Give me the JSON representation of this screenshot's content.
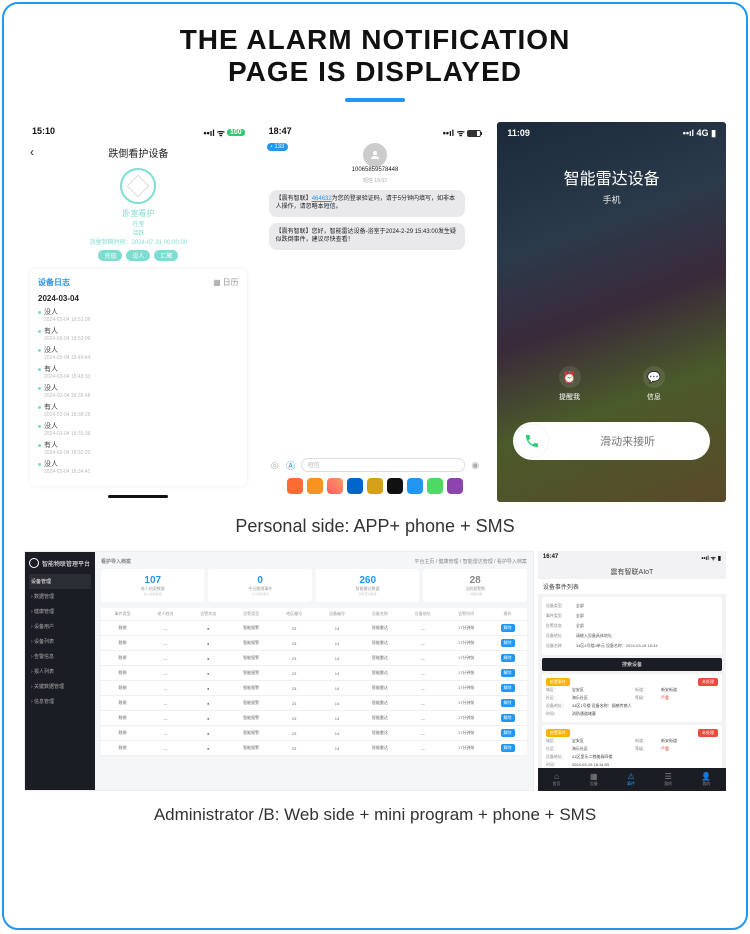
{
  "title_line1": "THE ALARM NOTIFICATION",
  "title_line2": "PAGE IS DISPLAYED",
  "phone1": {
    "time": "15:10",
    "battery": "100",
    "title": "跌倒看护设备",
    "device_name": "卧室看护",
    "device_state": "在室",
    "device_sub": "活跃",
    "device_time": "流量到期时间：2024-07-31 00:00:00",
    "chips": [
      "充值",
      "设人",
      "汇聚"
    ],
    "card_title": "设备日志",
    "calendar": "日历",
    "date": "2024-03-04",
    "logs": [
      {
        "label": "没人",
        "ts": "2024-03-04 18:52:09"
      },
      {
        "label": "有人",
        "ts": "2024-03-04 18:52:09"
      },
      {
        "label": "没人",
        "ts": "2024-03-04 18:48:44"
      },
      {
        "label": "有人",
        "ts": "2024-03-04 18:48:33"
      },
      {
        "label": "没人",
        "ts": "2024-03-04 18:38:48"
      },
      {
        "label": "有人",
        "ts": "2024-03-04 18:38:26"
      },
      {
        "label": "没人",
        "ts": "2024-03-04 18:35:38"
      },
      {
        "label": "有人",
        "ts": "2024-03-04 18:32:20"
      },
      {
        "label": "没人",
        "ts": "2024-03-04 18:34:41"
      }
    ]
  },
  "phone2": {
    "time": "18:47",
    "back_count": "133",
    "phone_number": "10065859578448",
    "meta": "短信 15:07",
    "msg1_prefix": "【震有智联】",
    "msg1_code": "464632",
    "msg1_rest": "为您的登录验证码，请于5分钟内填写，如非本人操作，请忽略本短信。",
    "msg2": "【震有智联】您好，智能雷达设备-浴室于2024-2-29 15:43:00发生疑似跌倒事件，建议尽快查看！",
    "compose_placeholder": "短信"
  },
  "phone3": {
    "time": "11:09",
    "signal": "4G",
    "caller_name": "智能雷达设备",
    "caller_sub": "手机",
    "opt_remind": "提醒我",
    "opt_message": "信息",
    "slide_text": "滑动来接听"
  },
  "caption_personal": "Personal side: APP+ phone + SMS",
  "web": {
    "brand": "智能物联管理平台",
    "section": "设备管理",
    "menu": [
      "数据管理",
      "健康管理",
      "设备用户",
      "设备列表",
      "告警信息",
      "报人列表",
      "关键数据管理",
      "信息管理"
    ],
    "crumb_title": "看护导入档案",
    "crumb": "平台主页 / 健康管理 / 智能雷达管理 / 看护导入档案",
    "stats": [
      {
        "n": "107",
        "l": "老人档案数据",
        "s": "在人档案数量"
      },
      {
        "n": "0",
        "l": "今日跌倒事件",
        "s": "今日跌倒事件"
      },
      {
        "n": "260",
        "l": "智能雷达数量",
        "s": "智能雷达数量"
      },
      {
        "n": "28",
        "l": "当前报警数",
        "s": "一周跌倒数"
      }
    ],
    "table_headers": [
      "事件类型",
      "老人姓名",
      "告警状态",
      "告警类型",
      "地区编号",
      "设备编号",
      "设备名称",
      "设备地址",
      "告警时间",
      "操作"
    ],
    "rows": [
      [
        "跌倒",
        "—",
        "●",
        "智能报警",
        "23",
        "14",
        "智能雷达",
        "—",
        "17分钟前"
      ],
      [
        "跌倒",
        "—",
        "●",
        "智能报警",
        "23",
        "14",
        "智能雷达",
        "—",
        "17分钟前"
      ],
      [
        "跌倒",
        "—",
        "●",
        "智能报警",
        "23",
        "14",
        "智能雷达",
        "—",
        "17分钟前"
      ],
      [
        "跌倒",
        "—",
        "●",
        "智能报警",
        "23",
        "14",
        "智能雷达",
        "—",
        "17分钟前"
      ],
      [
        "跌倒",
        "—",
        "●",
        "智能报警",
        "23",
        "14",
        "智能雷达",
        "—",
        "17分钟前"
      ],
      [
        "跌倒",
        "—",
        "●",
        "智能报警",
        "23",
        "14",
        "智能雷达",
        "—",
        "17分钟前"
      ],
      [
        "跌倒",
        "—",
        "●",
        "智能报警",
        "23",
        "14",
        "智能雷达",
        "—",
        "17分钟前"
      ],
      [
        "跌倒",
        "—",
        "●",
        "智能报警",
        "23",
        "14",
        "智能雷达",
        "—",
        "17分钟前"
      ],
      [
        "跌倒",
        "—",
        "●",
        "智能报警",
        "23",
        "14",
        "智能雷达",
        "—",
        "17分钟前"
      ]
    ],
    "op_label": "解除"
  },
  "mini": {
    "time": "16:47",
    "title": "震有智联AIoT",
    "subtitle": "设备事件列表",
    "form": [
      {
        "l": "设备类型",
        "v": "全部"
      },
      {
        "l": "事件类型",
        "v": "全部"
      },
      {
        "l": "告警状态",
        "v": "全部"
      },
      {
        "l": "设备地址",
        "v": "请输入设备具体地址"
      },
      {
        "l": "设备名称",
        "v": "34区4号楼4单元 设备名称：2024-03-18 16:34"
      }
    ],
    "query": "搜索设备",
    "alerts": [
      {
        "tag": "处置事件",
        "del": "未处理",
        "rows": [
          {
            "l": "城区：",
            "v": "宝安区",
            "l2": "街道：",
            "v2": "新安街道"
          },
          {
            "l": "社区：",
            "v": "海乐社区",
            "l2": "等级：",
            "v2": "严重",
            "red": true
          },
          {
            "l": "设备地址：",
            "v": "34区1号楼    设备名称：烟感传感人"
          },
          {
            "l": "时间：",
            "v": "消防通道堵塞"
          }
        ]
      },
      {
        "tag": "处置事件",
        "del": "未处理",
        "rows": [
          {
            "l": "城区：",
            "v": "宝安区",
            "l2": "街道：",
            "v2": "新安街道"
          },
          {
            "l": "社区：",
            "v": "海乐社区",
            "l2": "等级：",
            "v2": "严重",
            "red": true
          },
          {
            "l": "设备地址：",
            "v": "41区里乐二巷美具四楼"
          },
          {
            "l": "时间：",
            "v": "2024-03-19 18:14:53"
          }
        ]
      }
    ],
    "tabs": [
      "首页",
      "设备",
      "事件",
      "我的",
      "我的"
    ]
  },
  "caption_admin": "Administrator /B: Web side + mini program + phone + SMS"
}
